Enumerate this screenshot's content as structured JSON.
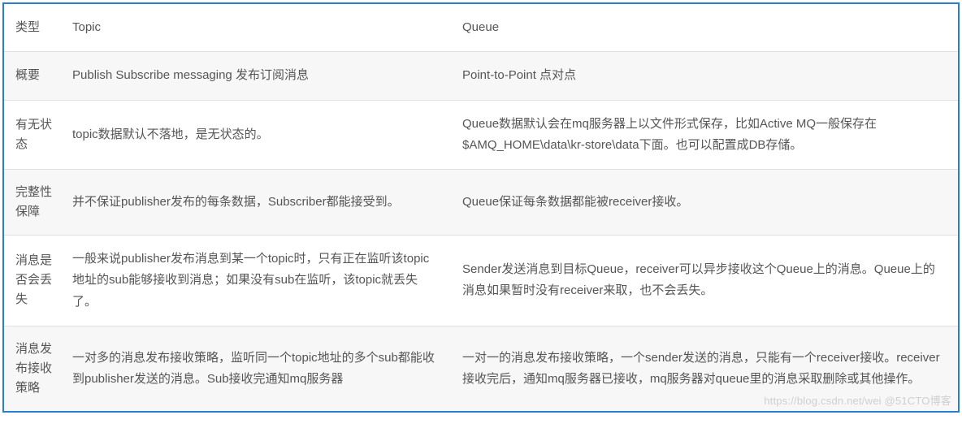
{
  "table": {
    "headers": {
      "type": "类型",
      "topic": "Topic",
      "queue": "Queue"
    },
    "rows": [
      {
        "label": "概要",
        "topic": "Publish Subscribe messaging 发布订阅消息",
        "queue": "Point-to-Point 点对点"
      },
      {
        "label": "有无状态",
        "topic": "topic数据默认不落地，是无状态的。",
        "queue": "Queue数据默认会在mq服务器上以文件形式保存，比如Active MQ一般保存在$AMQ_HOME\\data\\kr-store\\data下面。也可以配置成DB存储。"
      },
      {
        "label": "完整性保障",
        "topic": "并不保证publisher发布的每条数据，Subscriber都能接受到。",
        "queue": "Queue保证每条数据都能被receiver接收。"
      },
      {
        "label": "消息是否会丢失",
        "topic": "一般来说publisher发布消息到某一个topic时，只有正在监听该topic地址的sub能够接收到消息；如果没有sub在监听，该topic就丢失了。",
        "queue": "Sender发送消息到目标Queue，receiver可以异步接收这个Queue上的消息。Queue上的消息如果暂时没有receiver来取，也不会丢失。"
      },
      {
        "label": "消息发布接收策略",
        "topic": "一对多的消息发布接收策略，监听同一个topic地址的多个sub都能收到publisher发送的消息。Sub接收完通知mq服务器",
        "queue": "一对一的消息发布接收策略，一个sender发送的消息，只能有一个receiver接收。receiver接收完后，通知mq服务器已接收，mq服务器对queue里的消息采取删除或其他操作。"
      }
    ]
  },
  "watermark": "https://blog.csdn.net/wei @51CTO博客"
}
